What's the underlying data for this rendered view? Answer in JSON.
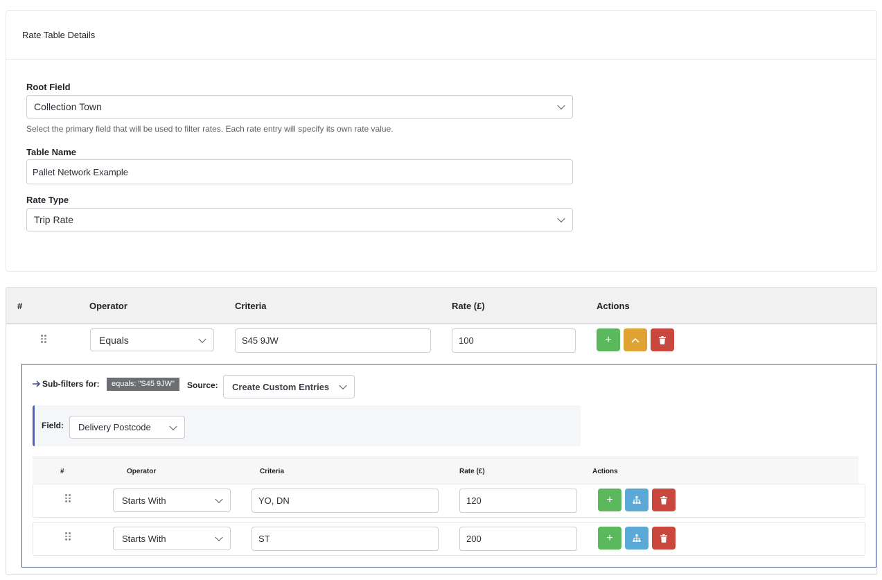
{
  "details": {
    "title": "Rate Table Details",
    "root_field_label": "Root Field",
    "root_field_value": "Collection Town",
    "root_field_help": "Select the primary field that will be used to filter rates. Each rate entry will specify its own rate value.",
    "table_name_label": "Table Name",
    "table_name_value": "Pallet Network Example",
    "rate_type_label": "Rate Type",
    "rate_type_value": "Trip Rate"
  },
  "table": {
    "headers": [
      "#",
      "Operator",
      "Criteria",
      "Rate (£)",
      "Actions"
    ],
    "rows": [
      {
        "operator": "Equals",
        "criteria": "S45 9JW",
        "rate": "100"
      }
    ]
  },
  "subfilters": {
    "title": "Sub-filters for:",
    "badge": "equals: \"S45 9JW\"",
    "source_label": "Source:",
    "source_value": "Create Custom Entries",
    "field_label": "Field:",
    "field_value": "Delivery Postcode",
    "headers": [
      "#",
      "Operator",
      "Criteria",
      "Rate (£)",
      "Actions"
    ],
    "rows": [
      {
        "operator": "Starts With",
        "criteria": "YO, DN",
        "rate": "120"
      },
      {
        "operator": "Starts With",
        "criteria": "ST",
        "rate": "200"
      }
    ]
  },
  "icons": {
    "add": "+",
    "collapse": "chevron-up-icon",
    "delete": "trash-icon",
    "subfilter": "sitemap-icon",
    "drag": "drag-handle-icon",
    "arrow": "arrow-right-icon"
  },
  "colors": {
    "green": "#5cb85c",
    "orange": "#e0a232",
    "red": "#c9473d",
    "blue": "#5aa8d6",
    "accent": "#4a5fc1"
  }
}
